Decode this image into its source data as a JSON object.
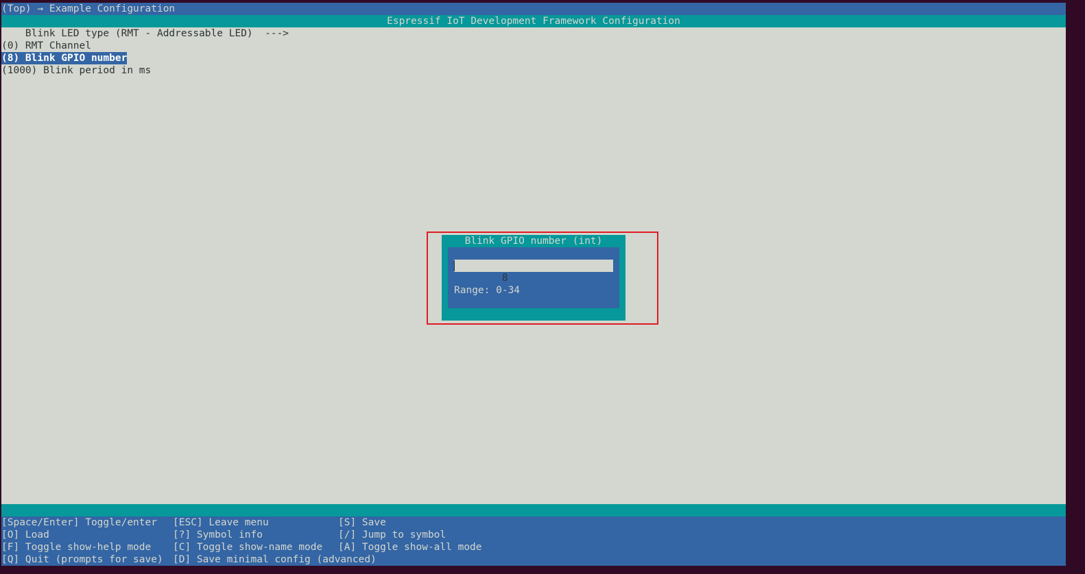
{
  "breadcrumb": "(Top) → Example Configuration",
  "title": "Espressif IoT Development Framework Configuration",
  "menu": {
    "items": [
      {
        "text": "    Blink LED type (RMT - Addressable LED)  --->"
      },
      {
        "text": "(0) RMT Channel"
      },
      {
        "text": "(8) Blink GPIO number"
      },
      {
        "text": "(1000) Blink period in ms"
      }
    ]
  },
  "dialog": {
    "title": "Blink GPIO number (int)",
    "input_value": "8",
    "range_text": "Range: 0-34"
  },
  "footer": {
    "keys": [
      {
        "text": "[Space/Enter] Toggle/enter"
      },
      {
        "text": "[ESC] Leave menu"
      },
      {
        "text": "[S] Save"
      },
      {
        "text": "[O] Load"
      },
      {
        "text": "[?] Symbol info"
      },
      {
        "text": "[/] Jump to symbol"
      },
      {
        "text": "[F] Toggle show-help mode"
      },
      {
        "text": "[C] Toggle show-name mode"
      },
      {
        "text": "[A] Toggle show-all mode"
      },
      {
        "text": "[Q] Quit (prompts for save)"
      },
      {
        "text": "[D] Save minimal config (advanced)"
      }
    ]
  },
  "colors": {
    "background": "#d3d7cf",
    "header_blue": "#3465a4",
    "title_teal": "#06989a",
    "highlight_outline": "#e01b24"
  }
}
